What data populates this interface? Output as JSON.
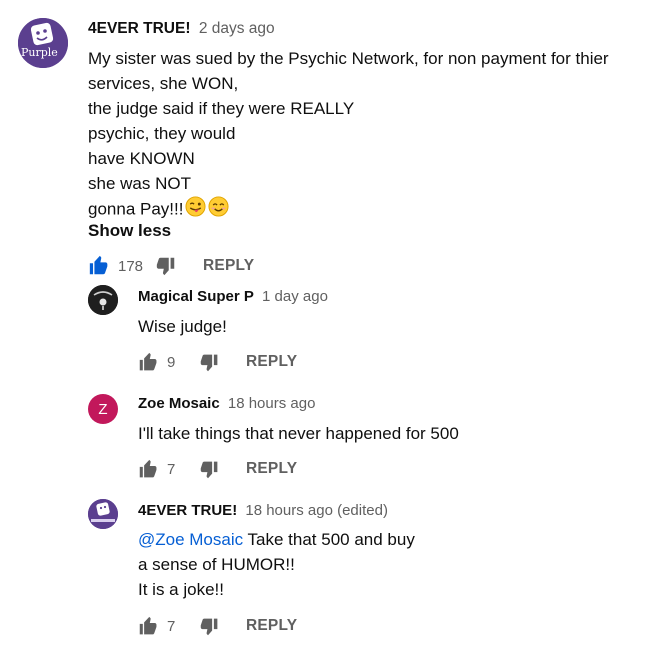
{
  "comments": [
    {
      "author": "4EVER TRUE!",
      "time": "2 days ago",
      "avatar_text": "Purple",
      "lines": [
        "My sister was sued by  the Psychic Network, for non payment for thier",
        "services, she WON,",
        "the judge said if they were REALLY",
        "psychic, they would",
        "have KNOWN",
        "she was NOT",
        "gonna Pay!!!"
      ],
      "emoji": [
        "winking-tongue-emoji",
        "smiling-eyes-emoji"
      ],
      "show_less": "Show less",
      "likes": "178",
      "liked": true,
      "reply_label": "REPLY"
    }
  ],
  "replies": [
    {
      "author": "Magical Super P",
      "time": "1 day ago",
      "avatar_icon": "dark-logo-avatar",
      "text": "Wise judge!",
      "likes": "9",
      "reply_label": "REPLY"
    },
    {
      "author": "Zoe Mosaic",
      "time": "18 hours ago",
      "avatar_letter": "Z",
      "text": "I'll take things that never happened for 500",
      "likes": "7",
      "reply_label": "REPLY"
    },
    {
      "author": "4EVER TRUE!",
      "time": "18 hours ago (edited)",
      "mention": "@Zoe Mosaic",
      "lines": [
        "Take that 500 and buy",
        "a sense of HUMOR!!",
        "It is a joke!!"
      ],
      "likes": "7",
      "reply_label": "REPLY"
    }
  ],
  "colors": {
    "liked_blue": "#065fd4",
    "link_blue": "#065fd4",
    "meta_gray": "#606060",
    "icon_gray": "#606060"
  }
}
